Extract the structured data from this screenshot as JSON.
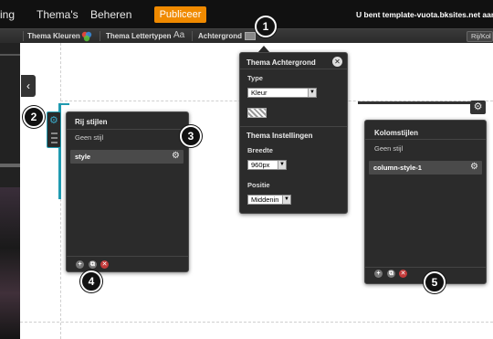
{
  "topnav": {
    "items": [
      "ing",
      "Thema's",
      "Beheren"
    ],
    "publish_label": "Publiceer",
    "user_text": "U bent template-vuota.bksites.net aan h"
  },
  "toolbar": {
    "theme_colors": "Thema Kleuren",
    "theme_fonts": "Thema Lettertypen",
    "fonts_icon_text": "Aa",
    "background": "Achtergrond",
    "right_btn": "Rij/Kol"
  },
  "row_panel": {
    "title": "Rij stijlen",
    "no_style": "Geen stijl",
    "style_item": "style"
  },
  "bg_panel": {
    "title": "Thema Achtergrond",
    "type_label": "Type",
    "type_value": "Kleur",
    "settings_title": "Thema Instellingen",
    "width_label": "Breedte",
    "width_value": "960px",
    "position_label": "Positie",
    "position_value": "Middenin"
  },
  "col_panel": {
    "title": "Kolomstijlen",
    "no_style": "Geen stijl",
    "style_item": "column-style-1"
  },
  "callouts": [
    "1",
    "2",
    "3",
    "4",
    "5"
  ],
  "colors": {
    "accent": "#1f9ab0",
    "publish": "#f08a00",
    "delete": "#c23a3a"
  }
}
